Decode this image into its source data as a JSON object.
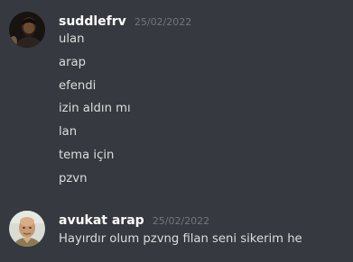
{
  "messages": [
    {
      "username": "suddlefrv",
      "timestamp": "25/02/2022",
      "avatar_icon": "dark-portrait-avatar",
      "lines": [
        "ulan",
        "arap",
        "efendi",
        "izin aldın mı",
        "lan",
        "tema için",
        "pzvn"
      ]
    },
    {
      "username": "avukat arap",
      "timestamp": "25/02/2022",
      "avatar_icon": "bald-man-portrait-avatar",
      "lines": [
        "Hayırdır olum pzvng filan seni sikerim he"
      ]
    }
  ],
  "colors": {
    "background": "#36393f",
    "username": "#ffffff",
    "timestamp": "#72767d",
    "message_text": "#dcddde"
  }
}
